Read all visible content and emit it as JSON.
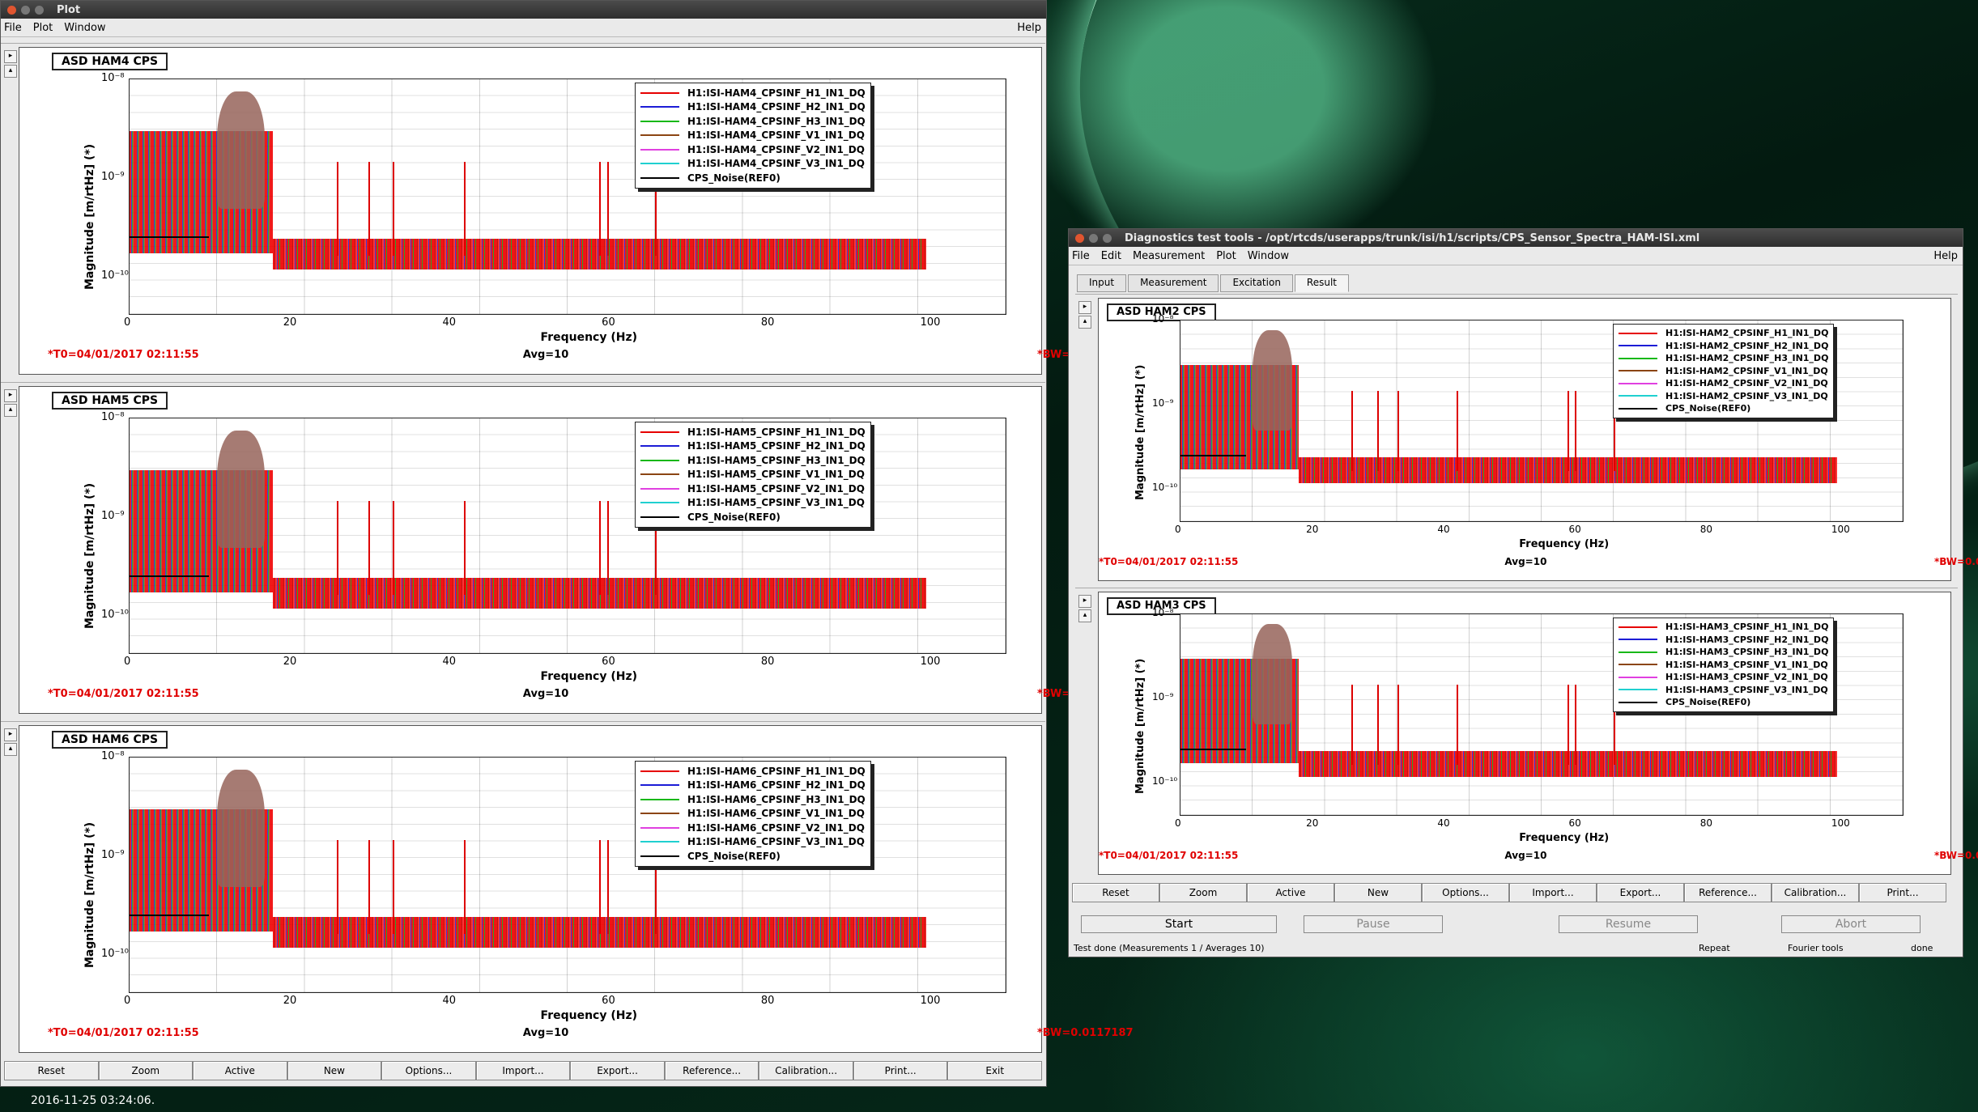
{
  "desktop": {
    "clock": "2016-11-25 03:24:06."
  },
  "plotwin": {
    "title": "Plot",
    "menu": [
      "File",
      "Plot",
      "Window"
    ],
    "help": "Help",
    "panels": [
      {
        "title": "ASD HAM4 CPS",
        "legend": [
          "H1:ISI-HAM4_CPSINF_H1_IN1_DQ",
          "H1:ISI-HAM4_CPSINF_H2_IN1_DQ",
          "H1:ISI-HAM4_CPSINF_H3_IN1_DQ",
          "H1:ISI-HAM4_CPSINF_V1_IN1_DQ",
          "H1:ISI-HAM4_CPSINF_V2_IN1_DQ",
          "H1:ISI-HAM4_CPSINF_V3_IN1_DQ",
          "CPS_Noise(REF0)"
        ]
      },
      {
        "title": "ASD HAM5 CPS",
        "legend": [
          "H1:ISI-HAM5_CPSINF_H1_IN1_DQ",
          "H1:ISI-HAM5_CPSINF_H2_IN1_DQ",
          "H1:ISI-HAM5_CPSINF_H3_IN1_DQ",
          "H1:ISI-HAM5_CPSINF_V1_IN1_DQ",
          "H1:ISI-HAM5_CPSINF_V2_IN1_DQ",
          "H1:ISI-HAM5_CPSINF_V3_IN1_DQ",
          "CPS_Noise(REF0)"
        ]
      },
      {
        "title": "ASD HAM6 CPS",
        "legend": [
          "H1:ISI-HAM6_CPSINF_H1_IN1_DQ",
          "H1:ISI-HAM6_CPSINF_H2_IN1_DQ",
          "H1:ISI-HAM6_CPSINF_H3_IN1_DQ",
          "H1:ISI-HAM6_CPSINF_V1_IN1_DQ",
          "H1:ISI-HAM6_CPSINF_V2_IN1_DQ",
          "H1:ISI-HAM6_CPSINF_V3_IN1_DQ",
          "CPS_Noise(REF0)"
        ]
      }
    ],
    "buttons": [
      "Reset",
      "Zoom",
      "Active",
      "New",
      "Options...",
      "Import...",
      "Export...",
      "Reference...",
      "Calibration...",
      "Print...",
      "Exit"
    ]
  },
  "dtt": {
    "title": "Diagnostics test tools - /opt/rtcds/userapps/trunk/isi/h1/scripts/CPS_Sensor_Spectra_HAM-ISI.xml",
    "menu": [
      "File",
      "Edit",
      "Measurement",
      "Plot",
      "Window"
    ],
    "help": "Help",
    "tabs": [
      "Input",
      "Measurement",
      "Excitation",
      "Result"
    ],
    "panels": [
      {
        "title": "ASD HAM2 CPS",
        "legend": [
          "H1:ISI-HAM2_CPSINF_H1_IN1_DQ",
          "H1:ISI-HAM2_CPSINF_H2_IN1_DQ",
          "H1:ISI-HAM2_CPSINF_H3_IN1_DQ",
          "H1:ISI-HAM2_CPSINF_V1_IN1_DQ",
          "H1:ISI-HAM2_CPSINF_V2_IN1_DQ",
          "H1:ISI-HAM2_CPSINF_V3_IN1_DQ",
          "CPS_Noise(REF0)"
        ]
      },
      {
        "title": "ASD HAM3 CPS",
        "legend": [
          "H1:ISI-HAM3_CPSINF_H1_IN1_DQ",
          "H1:ISI-HAM3_CPSINF_H2_IN1_DQ",
          "H1:ISI-HAM3_CPSINF_H3_IN1_DQ",
          "H1:ISI-HAM3_CPSINF_V1_IN1_DQ",
          "H1:ISI-HAM3_CPSINF_V2_IN1_DQ",
          "H1:ISI-HAM3_CPSINF_V3_IN1_DQ",
          "CPS_Noise(REF0)"
        ]
      }
    ],
    "buttons": [
      "Reset",
      "Zoom",
      "Active",
      "New",
      "Options...",
      "Import...",
      "Export...",
      "Reference...",
      "Calibration...",
      "Print..."
    ],
    "controls": [
      "Start",
      "Pause",
      "Resume",
      "Abort"
    ],
    "status": {
      "msg": "Test done (Measurements 1 / Averages 10)",
      "repeat": "Repeat",
      "fourier": "Fourier tools",
      "done": "done"
    }
  },
  "common": {
    "ylabel": "Magnitude [m/rtHz] (*)",
    "xlabel": "Frequency (Hz)",
    "yticks": [
      "10⁻⁸",
      "10⁻⁹",
      "10⁻¹⁰"
    ],
    "xticks": [
      "0",
      "20",
      "40",
      "60",
      "80",
      "100"
    ],
    "t0": "*T0=04/01/2017 02:11:55",
    "avg": "Avg=10",
    "bw": "*BW=0.0117187"
  },
  "series_colors": [
    "#e60000",
    "#1c1cd6",
    "#18b818",
    "#8b4513",
    "#e040e0",
    "#20d0d0",
    "#000000"
  ],
  "chart_data": [
    {
      "type": "line",
      "title": "ASD HAM4 CPS",
      "xlabel": "Frequency (Hz)",
      "ylabel": "Magnitude [m/rtHz] (*)",
      "xlim": [
        0,
        110
      ],
      "ylim": [
        1e-10,
        1e-08
      ],
      "yscale": "log",
      "series": [
        {
          "name": "H1:ISI-HAM4_CPSINF_H1_IN1_DQ"
        },
        {
          "name": "H1:ISI-HAM4_CPSINF_H2_IN1_DQ"
        },
        {
          "name": "H1:ISI-HAM4_CPSINF_H3_IN1_DQ"
        },
        {
          "name": "H1:ISI-HAM4_CPSINF_V1_IN1_DQ"
        },
        {
          "name": "H1:ISI-HAM4_CPSINF_V2_IN1_DQ"
        },
        {
          "name": "H1:ISI-HAM4_CPSINF_V3_IN1_DQ"
        },
        {
          "name": "CPS_Noise(REF0)",
          "x": [
            0,
            10,
            10,
            100
          ],
          "y": [
            2e-10,
            2e-10,
            1.2e-10,
            1.2e-10
          ]
        }
      ]
    },
    {
      "type": "line",
      "title": "ASD HAM5 CPS",
      "xlabel": "Frequency (Hz)",
      "ylabel": "Magnitude [m/rtHz] (*)",
      "xlim": [
        0,
        110
      ],
      "ylim": [
        1e-10,
        1e-08
      ],
      "yscale": "log",
      "series": [
        {
          "name": "H1:ISI-HAM5_CPSINF_H1_IN1_DQ"
        },
        {
          "name": "H1:ISI-HAM5_CPSINF_H2_IN1_DQ"
        },
        {
          "name": "H1:ISI-HAM5_CPSINF_H3_IN1_DQ"
        },
        {
          "name": "H1:ISI-HAM5_CPSINF_V1_IN1_DQ"
        },
        {
          "name": "H1:ISI-HAM5_CPSINF_V2_IN1_DQ"
        },
        {
          "name": "H1:ISI-HAM5_CPSINF_V3_IN1_DQ"
        },
        {
          "name": "CPS_Noise(REF0)",
          "x": [
            0,
            10,
            10,
            100
          ],
          "y": [
            2e-10,
            2e-10,
            1.2e-10,
            1.2e-10
          ]
        }
      ]
    },
    {
      "type": "line",
      "title": "ASD HAM6 CPS",
      "xlabel": "Frequency (Hz)",
      "ylabel": "Magnitude [m/rtHz] (*)",
      "xlim": [
        0,
        110
      ],
      "ylim": [
        1e-10,
        1e-08
      ],
      "yscale": "log",
      "series": [
        {
          "name": "H1:ISI-HAM6_CPSINF_H1_IN1_DQ"
        },
        {
          "name": "H1:ISI-HAM6_CPSINF_H2_IN1_DQ"
        },
        {
          "name": "H1:ISI-HAM6_CPSINF_H3_IN1_DQ"
        },
        {
          "name": "H1:ISI-HAM6_CPSINF_V1_IN1_DQ"
        },
        {
          "name": "H1:ISI-HAM6_CPSINF_V2_IN1_DQ"
        },
        {
          "name": "H1:ISI-HAM6_CPSINF_V3_IN1_DQ"
        },
        {
          "name": "CPS_Noise(REF0)",
          "x": [
            0,
            10,
            10,
            100
          ],
          "y": [
            2e-10,
            2e-10,
            1.2e-10,
            1.2e-10
          ]
        }
      ]
    },
    {
      "type": "line",
      "title": "ASD HAM2 CPS",
      "xlabel": "Frequency (Hz)",
      "ylabel": "Magnitude [m/rtHz] (*)",
      "xlim": [
        0,
        110
      ],
      "ylim": [
        1e-10,
        1e-08
      ],
      "yscale": "log",
      "series": [
        {
          "name": "H1:ISI-HAM2_CPSINF_H1_IN1_DQ"
        },
        {
          "name": "H1:ISI-HAM2_CPSINF_H2_IN1_DQ"
        },
        {
          "name": "H1:ISI-HAM2_CPSINF_H3_IN1_DQ"
        },
        {
          "name": "H1:ISI-HAM2_CPSINF_V1_IN1_DQ"
        },
        {
          "name": "H1:ISI-HAM2_CPSINF_V2_IN1_DQ"
        },
        {
          "name": "H1:ISI-HAM2_CPSINF_V3_IN1_DQ"
        },
        {
          "name": "CPS_Noise(REF0)",
          "x": [
            0,
            10,
            10,
            100
          ],
          "y": [
            2e-10,
            2e-10,
            1.2e-10,
            1.2e-10
          ]
        }
      ]
    },
    {
      "type": "line",
      "title": "ASD HAM3 CPS",
      "xlabel": "Frequency (Hz)",
      "ylabel": "Magnitude [m/rtHz] (*)",
      "xlim": [
        0,
        110
      ],
      "ylim": [
        1e-10,
        1e-08
      ],
      "yscale": "log",
      "series": [
        {
          "name": "H1:ISI-HAM3_CPSINF_H1_IN1_DQ"
        },
        {
          "name": "H1:ISI-HAM3_CPSINF_H2_IN1_DQ"
        },
        {
          "name": "H1:ISI-HAM3_CPSINF_H3_IN1_DQ"
        },
        {
          "name": "H1:ISI-HAM3_CPSINF_V1_IN1_DQ"
        },
        {
          "name": "H1:ISI-HAM3_CPSINF_V2_IN1_DQ"
        },
        {
          "name": "H1:ISI-HAM3_CPSINF_V3_IN1_DQ"
        },
        {
          "name": "CPS_Noise(REF0)",
          "x": [
            0,
            10,
            10,
            100
          ],
          "y": [
            2e-10,
            2e-10,
            1.2e-10,
            1.2e-10
          ]
        }
      ]
    }
  ]
}
